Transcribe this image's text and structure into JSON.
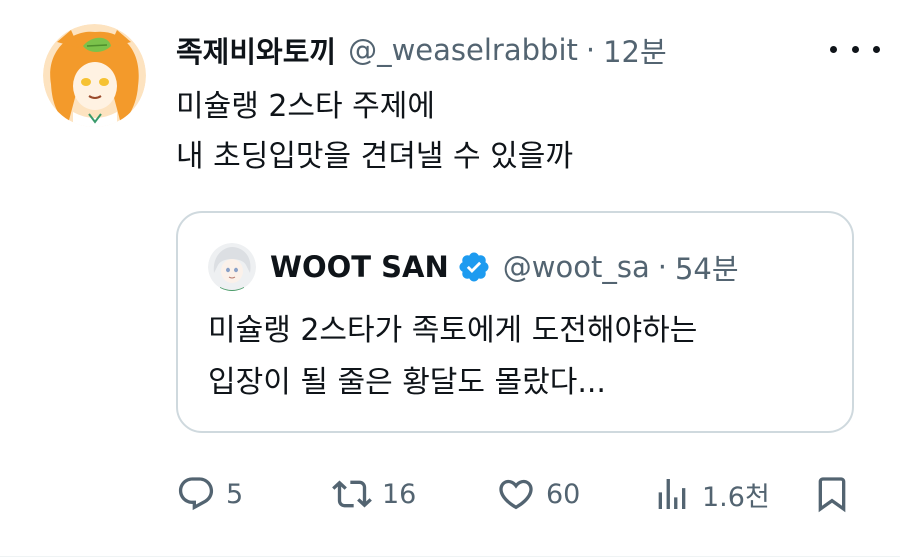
{
  "tweet": {
    "author": {
      "display_name": "족제비와토끼",
      "handle": "@_weaselrabbit",
      "avatar": "cartoon-avatar-orange-hair"
    },
    "separator": "·",
    "time": "12분",
    "more_icon": "more-horizontal-icon",
    "text_lines": [
      "미슐랭 2스타 주제에",
      "내 초딩입맛을 견뎌낼 수 있을까"
    ]
  },
  "quote": {
    "author": {
      "display_name": "WOOT SAN",
      "verified": true,
      "handle": "@woot_sa",
      "avatar": "cartoon-avatar-white-hair"
    },
    "separator": "·",
    "time": "54분",
    "text_lines": [
      "미슐랭 2스타가 족토에게 도전해야하는",
      "입장이 될 줄은 황달도 몰랐다..."
    ]
  },
  "actions": {
    "reply": {
      "icon": "reply-icon",
      "count": "5"
    },
    "retweet": {
      "icon": "retweet-icon",
      "count": "16"
    },
    "like": {
      "icon": "heart-icon",
      "count": "60"
    },
    "views": {
      "icon": "views-icon",
      "count": "1.6천"
    },
    "bookmark": {
      "icon": "bookmark-icon"
    }
  },
  "colors": {
    "text": "#0f1419",
    "secondary": "#536471",
    "border": "#cfd9de",
    "verified": "#1d9bf0"
  }
}
